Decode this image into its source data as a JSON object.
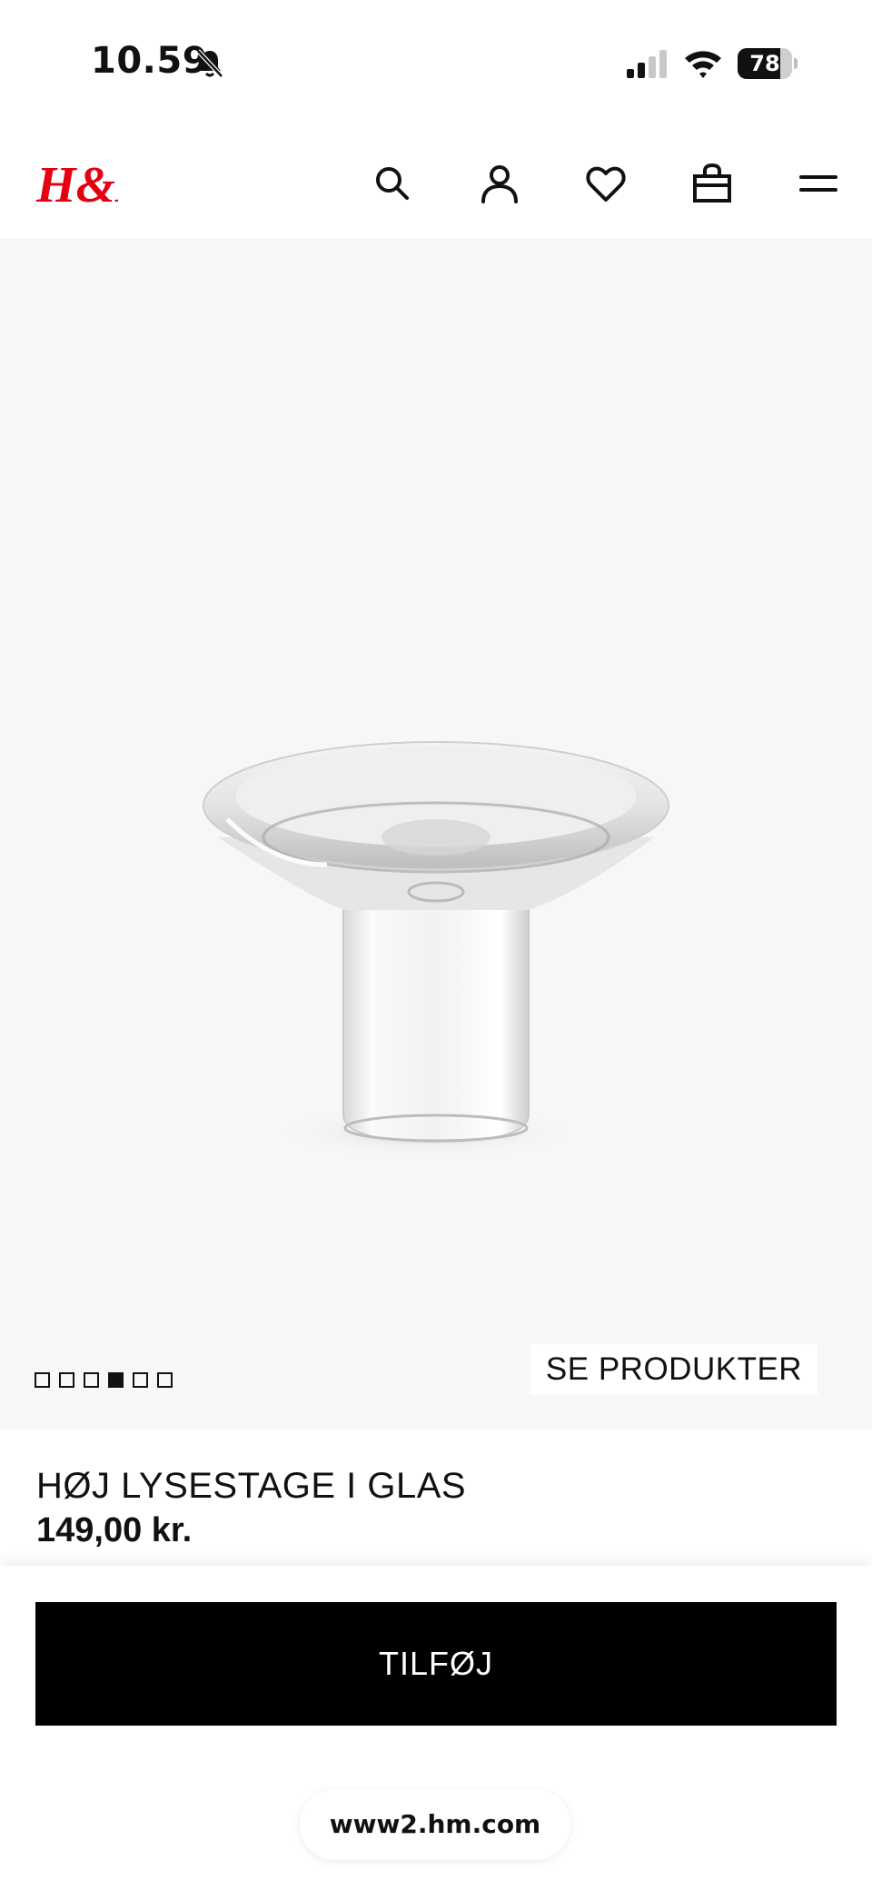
{
  "status_bar": {
    "time": "10.59",
    "battery": "78",
    "battery_level": 0.78,
    "icons": [
      "bell-muted-icon",
      "signal-icon",
      "wifi-icon",
      "battery-icon"
    ]
  },
  "header": {
    "logo_text": "H&M",
    "brand_color": "#e50010",
    "icons": [
      "search-icon",
      "account-icon",
      "heart-icon",
      "bag-icon",
      "menu-icon"
    ]
  },
  "gallery": {
    "image_count": 6,
    "active_index": 3,
    "see_products_label": "SE PRODUKTER"
  },
  "product": {
    "name": "HØJ LYSESTAGE I GLAS",
    "price": "149,00 kr."
  },
  "bottom_sheet": {
    "add_button_label": "TILFØJ",
    "url": "www2.hm.com"
  }
}
